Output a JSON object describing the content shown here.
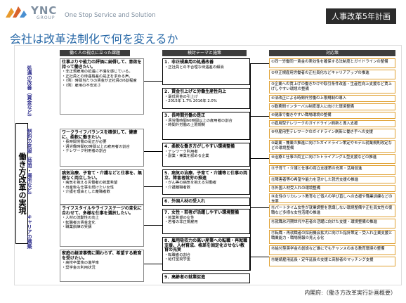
{
  "header": {
    "logo": "YNC",
    "logo_sub": "GROUP",
    "slogan": "One Stop Service and Solution",
    "badge": "人事改革5年計画"
  },
  "title": "会社は改革法制化で何を変えるか",
  "side_label": "働き方改革の実現",
  "categories": [
    "処遇の改善（賃金など）",
    "制約の克服（時間・場所など）",
    "キャリアの構築"
  ],
  "columns": [
    "働く人の視点に立った課題",
    "検討テーマと施策",
    "対応策"
  ],
  "issues": [
    {
      "title": "仕事ぶりや能力の評価に納得して、意欲を持って働きたい。",
      "text": "・非正規雇用の処遇に不満を感じている。\n・正社員との待遇格差の是正を求める声。\n・（例）時間当たりの賃金が正社員の6割程度\n・（例）雇用の不安定さ"
    },
    {
      "title": "ワークライフバランスを確保して、健康に、柔軟に働きたい。",
      "text": "・長時間労働の是正が必要\n・週労働時間60時間以上の雇用者の割合\n・テレワーク利用者の割合"
    },
    {
      "title": "病気治療、子育て・介護などと仕事を、無理なく両立したい。",
      "text": "・病気を抱える労働者の就業希望\n・出産後も仕事を続けたい女性\n・介護を理由とした離職者数"
    },
    {
      "title": "ライフスタイルやライフステージの変化に合わせて、多様な仕事を選択したい。",
      "text": "・人材の流動性の向上\n・転職者の賃金変化\n・職業訓練の受講"
    },
    {
      "title": "家庭の経済事情に関わらず、希望する教育を受けたい。",
      "text": "・高校卒業後の進学率\n・奨学金の利用状況"
    }
  ],
  "themes": [
    {
      "title": "1．非正規雇用の処遇改善",
      "text": "・正社員との不合理な待遇差の解消"
    },
    {
      "title": "2．賃金引上げと労働生産性向上",
      "text": "・最低賃金の引上げ\n・2015年 1.7%  2016年 2.0%"
    },
    {
      "title": "3．長時間労働の是正",
      "text": "・週労働時間60時間以上の雇用者の割合\n・時間外労働の上限規制"
    },
    {
      "title": "4．柔軟な働き方がしやすい環境整備",
      "text": "・テレワーク利用者\n・副業・兼業を認める企業"
    },
    {
      "title": "5．病気の治療、子育て・介護等と仕事の両立、障害者就労の推進",
      "text": "・がん等の病気を抱える労働者\n・介護離職者数"
    },
    {
      "title": "6．外国人材の受入れ",
      "text": ""
    },
    {
      "title": "7．女性・若者が活躍しやすい環境整備",
      "text": "・就業希望の女性\n・若者の非正規雇用"
    },
    {
      "title": "8．雇用吸収力の高い産業への転職・再就職支援、人材育成、格差を固定化させない教育の充実",
      "text": "・転職者の割合\n・給付型奨学金"
    },
    {
      "title": "9．高齢者の就業促進",
      "text": "・65歳以上の就業率"
    }
  ],
  "measures": [
    "①同一労働同一賃金の実効性を確保する法制度とガイドラインの整備",
    "②非正規雇用労働者の正社員化などキャリアアップの推進",
    "③企業への賃上げの働きかけや取引条件改善・生産性向上支援など賃上げしやすい環境の整備",
    "④法改正による時間外労働の上限規制の導入",
    "⑤勤務間インターバル制度導入に向けた環境整備",
    "⑥健康で働きやすい職場環境の整備",
    "⑦雇用型テレワークのガイドライン刷新と導入支援",
    "⑧非雇用型テレワークのガイドライン刷新と働き手への支援",
    "⑨副業・兼業の推進に向けたガイドライン策定やモデル就業規則改定などの環境整備",
    "⑩治療と仕事の両立に向けたトライアングル型支援などの推進",
    "⑪子育て・介護と仕事の両立支援策の充実・活用促進",
    "⑫障害者等の希望や能力を活かした就労支援の推進",
    "⑬外国人材受入れの環境整備",
    "⑭女性のリカレント教育など個人の学び直しへの支援や職業訓練などの充実",
    "⑮パートタイム女性が就業調整を意識しない環境整備や正社員女性の復職など多様な女性活躍の推進",
    "⑯就職氷河期世代や若者の活躍に向けた支援・環境整備の推進",
    "⑰転職・再就職者の採用機会拡大に向けた指針策定・受入れ企業支援と職業能力・職場情報の見える化",
    "⑱給付型奨学金の創設など誰にでもチャンスのある教育環境の整備",
    "⑲継続雇用延長・定年延長の支援と高齢者のマッチング支援"
  ],
  "footer": "内閣府:（働き方改革実行計画概要）"
}
